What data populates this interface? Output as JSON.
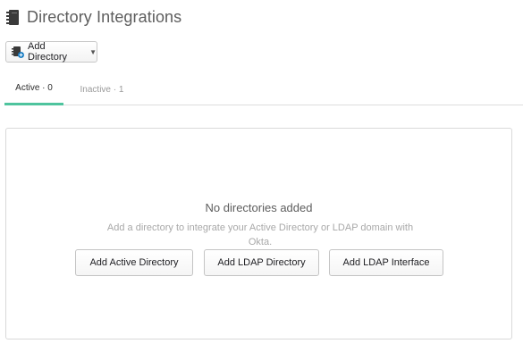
{
  "header": {
    "title": "Directory Integrations",
    "icon": "book-directory-icon"
  },
  "toolbar": {
    "add_directory_label": "Add Directory",
    "add_icon": "directory-add-icon",
    "caret_icon": "caret-down-icon"
  },
  "tabs": [
    {
      "label": "Active · 0",
      "active": true
    },
    {
      "label": "Inactive · 1",
      "active": false
    }
  ],
  "empty_state": {
    "title": "No directories added",
    "description": "Add a directory to integrate your Active Directory or LDAP domain with Okta.",
    "buttons": [
      {
        "label": "Add Active Directory"
      },
      {
        "label": "Add LDAP Directory"
      },
      {
        "label": "Add LDAP Interface"
      }
    ]
  },
  "colors": {
    "accent": "#4fc49e",
    "text": "#5d5d5d",
    "muted": "#a8a8a8",
    "border": "#d9d9d9"
  }
}
